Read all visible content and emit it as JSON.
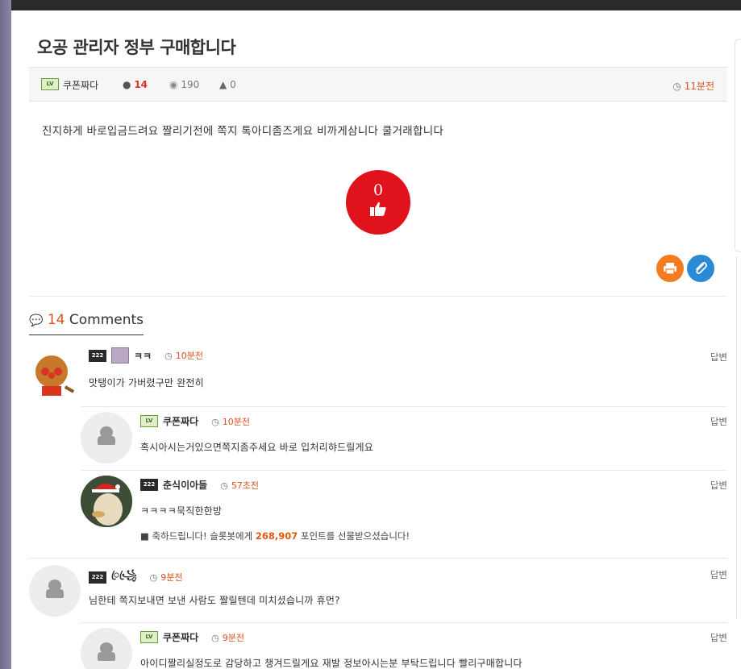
{
  "post": {
    "title": "오공 관리자 정부 구매합니다",
    "author": "쿠폰짜다",
    "author_level": "LV",
    "comment_count": "14",
    "views": "190",
    "likes": "0",
    "time": "11분전",
    "content": "진지하게 바로입금드려요 짤리기전에 쪽지 톡아디좀즈게요 비까게삼니다 쿨거래합니다",
    "like_button_count": "0"
  },
  "comments_header": {
    "count": "14",
    "label": "Comments"
  },
  "comments": [
    {
      "author": "ㅋㅋ",
      "time": "10분전",
      "text": "맛탱이가 가버렸구만 완전히",
      "reply_label": "답변"
    },
    {
      "author": "쿠폰짜다",
      "time": "10분전",
      "text": "혹시아시는거있으면쪽지좀주세요 바로 입처리햐드릴게요",
      "reply_label": "답변"
    },
    {
      "author": "춘식이아들",
      "time": "57초전",
      "text": "ㅋㅋㅋㅋ묵직한한방",
      "gift_prefix": "축하드립니다! 슬롯봇에게",
      "gift_points": "268,907",
      "gift_suffix": "포인트를 선물받으셨습니다!",
      "reply_label": "답변"
    },
    {
      "author": "ꦿ꧁ꦿ",
      "time": "9분전",
      "text": "님한테 쪽지보내면 보낸 사람도 짤릴텐데 미치셨습니까 휴먼?",
      "reply_label": "답변"
    },
    {
      "author": "쿠폰짜다",
      "time": "9분전",
      "text": "아이디짤리실정도로 감당하고 챙겨드릴게요 재발 정보아시는분 부탁드립니다 빨리구매합니다",
      "reply_label": "답변"
    }
  ],
  "colors": {
    "accent_red": "#e0121c",
    "time_orange": "#d9541f",
    "print_orange": "#f47b20",
    "attach_blue": "#2a8ad4"
  }
}
